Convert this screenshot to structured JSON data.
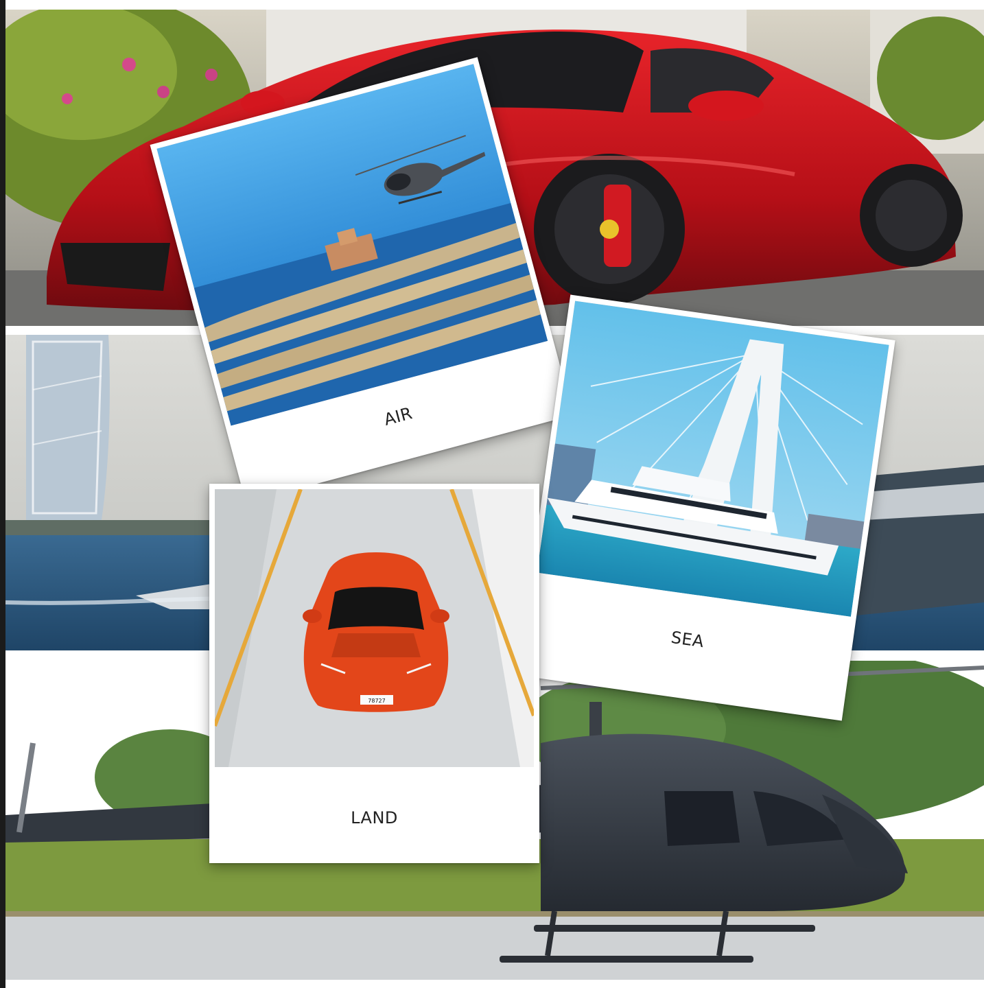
{
  "cards": {
    "air": {
      "caption": "AIR"
    },
    "sea": {
      "caption": "SEA"
    },
    "land": {
      "caption": "LAND",
      "plate": "78727"
    }
  },
  "colors": {
    "ferrari_red": "#c8121b",
    "lamborghini_orange": "#e04416",
    "sky_blue": "#5bb7ea",
    "sea_blue": "#2a5a85",
    "helicopter_gray": "#3a3f48",
    "card_white": "#ffffff"
  },
  "icons": [
    "red-sports-car-photo",
    "yacht-sea-photo",
    "helicopter-photo",
    "atlantis-palm-photo",
    "ain-dubai-yacht-photo",
    "orange-supercar-photo"
  ]
}
